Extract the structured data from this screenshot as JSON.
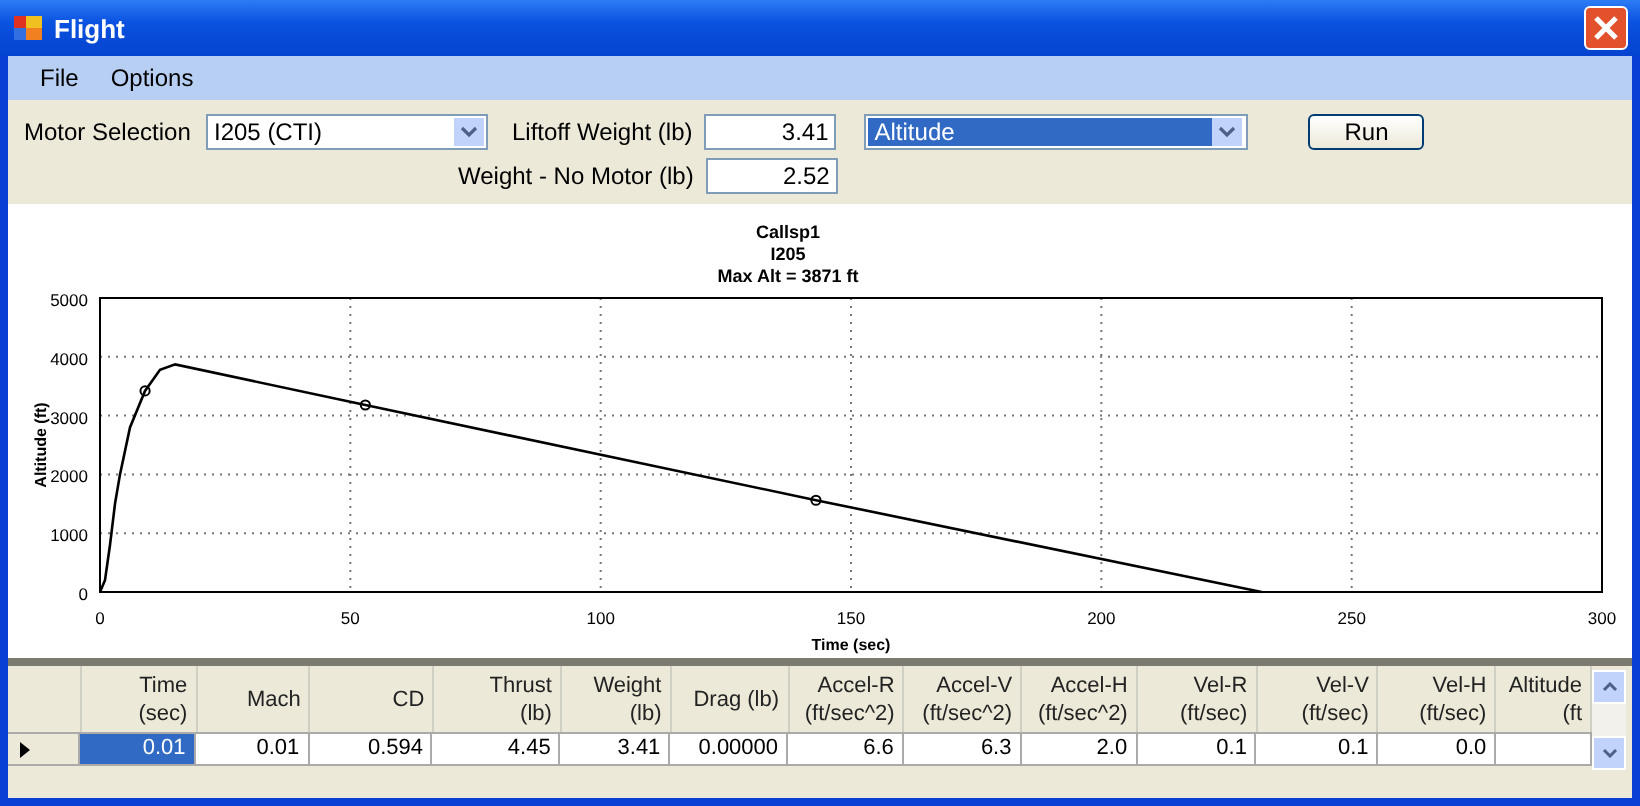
{
  "window": {
    "title": "Flight"
  },
  "menu": [
    "File",
    "Options"
  ],
  "controls": {
    "motor_label": "Motor Selection",
    "motor_value": "I205  (CTI)",
    "liftoff_label": "Liftoff Weight (lb)",
    "liftoff_value": "3.41",
    "nomotor_label": "Weight - No Motor (lb)",
    "nomotor_value": "2.52",
    "plot_value": "Altitude",
    "run_button": "Run"
  },
  "chart": {
    "subtitle_lines": [
      "I205",
      "Max Alt = 3871 ft"
    ],
    "chart_data": {
      "type": "line",
      "grid": true,
      "title": "Callsp1",
      "xlabel": "Time (sec)",
      "ylabel": "Altitude (ft)",
      "xlim": [
        0,
        300
      ],
      "ylim": [
        0,
        5000
      ],
      "xticks": [
        0,
        50,
        100,
        150,
        200,
        250,
        300
      ],
      "yticks": [
        0,
        1000,
        2000,
        3000,
        4000,
        5000
      ],
      "x": [
        0,
        1,
        2,
        3,
        4,
        6,
        9,
        12,
        15,
        53,
        143,
        232
      ],
      "series": [
        {
          "color": "#000000",
          "values": [
            0,
            200,
            800,
            1500,
            2000,
            2800,
            3420,
            3780,
            3870,
            3180,
            1560,
            0
          ]
        }
      ]
    }
  },
  "table": {
    "columns": [
      "Time\n(sec)",
      "Mach",
      "CD",
      "Thrust\n(lb)",
      "Weight\n(lb)",
      "Drag (lb)",
      "Accel-R\n(ft/sec^2)",
      "Accel-V\n(ft/sec^2)",
      "Accel-H\n(ft/sec^2)",
      "Vel-R\n(ft/sec)",
      "Vel-V\n(ft/sec)",
      "Vel-H\n(ft/sec)",
      "Altitude\n(ft"
    ],
    "rows": [
      {
        "selected": true,
        "cells": [
          {
            "text": "0.01",
            "selected": true
          },
          {
            "text": "0.01",
            "selected": false
          },
          {
            "text": "0.594",
            "selected": false
          },
          {
            "text": "4.45",
            "selected": false
          },
          {
            "text": "3.41",
            "selected": false
          },
          {
            "text": "0.00000",
            "selected": false
          },
          {
            "text": "6.6",
            "selected": false
          },
          {
            "text": "6.3",
            "selected": false
          },
          {
            "text": "2.0",
            "selected": false
          },
          {
            "text": "0.1",
            "selected": false
          },
          {
            "text": "0.1",
            "selected": false
          },
          {
            "text": "0.0",
            "selected": false
          }
        ]
      }
    ]
  }
}
